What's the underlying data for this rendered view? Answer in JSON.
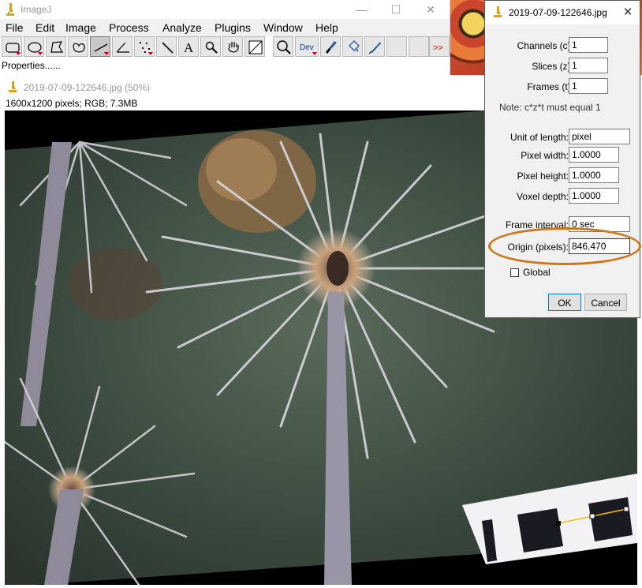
{
  "desktop": {
    "wallpaper_colors": [
      "#f4d35e",
      "#c9462c",
      "#e87a3a",
      "#3b2a1a"
    ]
  },
  "imagej": {
    "title": "ImageJ",
    "window_controls": [
      "—",
      "☐",
      "✕"
    ],
    "menu": [
      "File",
      "Edit",
      "Image",
      "Process",
      "Analyze",
      "Plugins",
      "Window",
      "Help"
    ],
    "tools": [
      {
        "name": "rectangle-tool",
        "icon": "rectangle-icon"
      },
      {
        "name": "oval-tool",
        "icon": "oval-icon"
      },
      {
        "name": "polygon-tool",
        "icon": "polygon-icon"
      },
      {
        "name": "freehand-tool",
        "icon": "freehand-icon"
      },
      {
        "name": "straight-line-tool",
        "icon": "line-icon"
      },
      {
        "name": "angle-tool",
        "icon": "angle-icon"
      },
      {
        "name": "multipoint-tool",
        "icon": "multipoint-icon"
      },
      {
        "name": "wand-tool",
        "icon": "wand-icon"
      },
      {
        "name": "text-tool",
        "icon": "text-icon",
        "label": "A"
      },
      {
        "name": "magnifying-tool",
        "icon": "magnifier-icon"
      },
      {
        "name": "scrolling-tool",
        "icon": "hand-icon"
      },
      {
        "name": "color-picker-tool",
        "icon": "color-picker-icon"
      },
      {
        "name": "zoom-tool",
        "icon": "search-icon"
      },
      {
        "name": "developer-menu",
        "icon": "dev-icon",
        "label": "Dev"
      },
      {
        "name": "brush-tool",
        "icon": "brush-icon"
      },
      {
        "name": "flood-fill-tool",
        "icon": "flood-fill-icon"
      },
      {
        "name": "pencil-tool",
        "icon": "pencil-icon"
      },
      {
        "name": "blank-tool-1",
        "icon": ""
      },
      {
        "name": "blank-tool-2",
        "icon": ""
      },
      {
        "name": "more-tools",
        "icon": "more-icon",
        "label": ">>"
      }
    ],
    "status": "Properties......"
  },
  "image_window": {
    "title": "2019-07-09-122646.jpg (50%)",
    "info": "1600x1200 pixels; RGB; 7.3MB"
  },
  "properties_dialog": {
    "title": "2019-07-09-122646.jpg",
    "close_label": "✕",
    "fields": {
      "channels": {
        "label": "Channels (c):",
        "value": "1"
      },
      "slices": {
        "label": "Slices (z):",
        "value": "1"
      },
      "frames": {
        "label": "Frames (t):",
        "value": "1"
      },
      "unit": {
        "label": "Unit of length:",
        "value": "pixel"
      },
      "pixel_width": {
        "label": "Pixel width:",
        "value": "1.0000"
      },
      "pixel_height": {
        "label": "Pixel height:",
        "value": "1.0000"
      },
      "voxel_depth": {
        "label": "Voxel depth:",
        "value": "1.0000"
      },
      "frame_interval": {
        "label": "Frame interval:",
        "value": "0 sec"
      },
      "origin": {
        "label": "Origin (pixels):",
        "value": "846,470"
      }
    },
    "note": "Note: c*z*t must equal 1",
    "global_label": "Global",
    "global_checked": false,
    "ok_label": "OK",
    "cancel_label": "Cancel"
  },
  "colors": {
    "highlight": "#c9771a",
    "selection_line": "#f0c000"
  }
}
